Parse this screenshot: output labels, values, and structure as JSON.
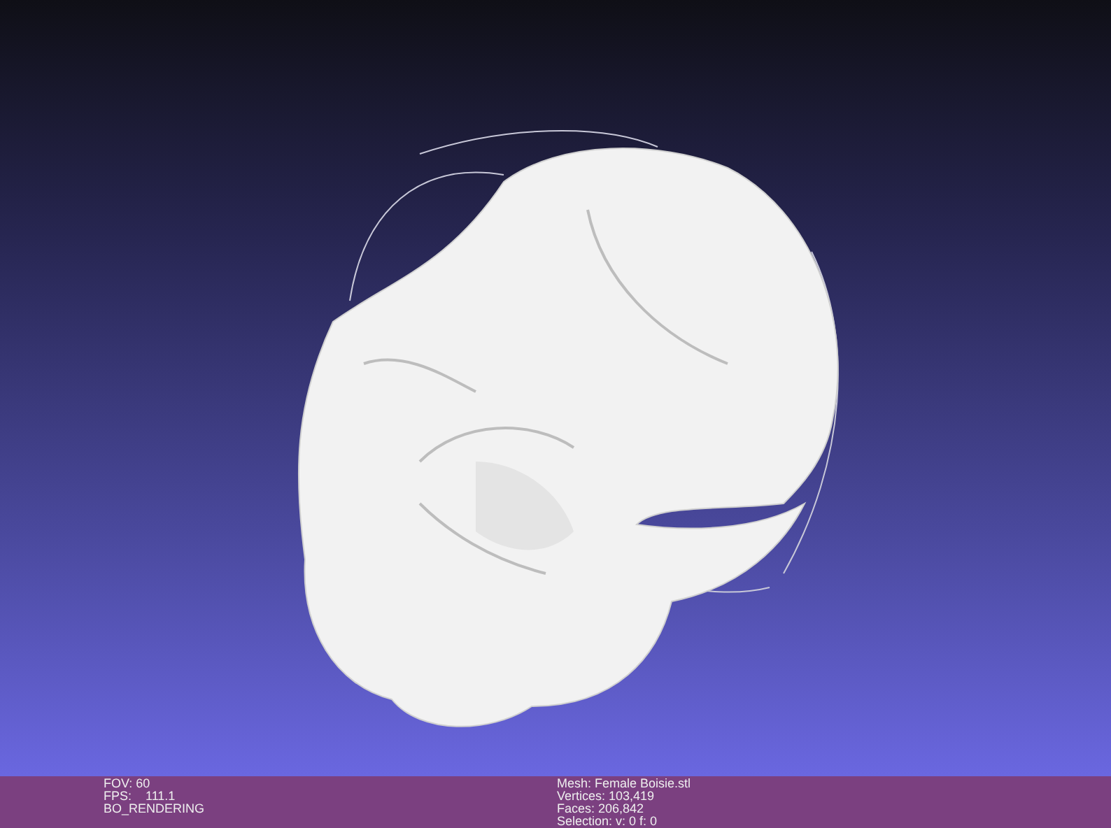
{
  "info_left": [
    "FOV: 60",
    "FPS:    111.1",
    "BO_RENDERING"
  ],
  "info_right": [
    "Mesh: Female Boisie.stl",
    "Vertices: 103,419",
    "Faces: 206,842",
    "Selection: v: 0 f: 0"
  ]
}
